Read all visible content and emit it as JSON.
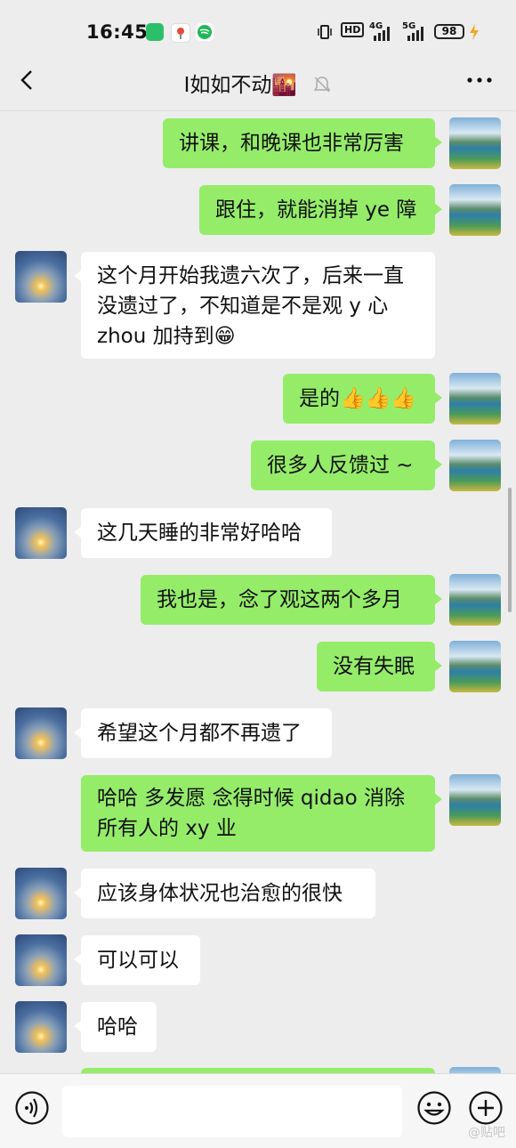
{
  "status": {
    "time": "16:45",
    "hd": "HD",
    "net1": "4G",
    "net2": "5G",
    "battery": "98"
  },
  "header": {
    "title": "I如如不动🌇"
  },
  "messages": [
    {
      "side": "me",
      "text": "讲课，和晚课也非常厉害"
    },
    {
      "side": "me",
      "text": "跟住，就能消掉 ye 障"
    },
    {
      "side": "other",
      "text": "这个月开始我遗六次了，后来一直\n没遗过了，不知道是不是观 y 心\nzhou 加持到😁"
    },
    {
      "side": "me",
      "text": "是的👍👍👍"
    },
    {
      "side": "me",
      "text": "很多人反馈过 ~"
    },
    {
      "side": "other",
      "text": "这几天睡的非常好哈哈"
    },
    {
      "side": "me",
      "text": "我也是，念了观这两个多月"
    },
    {
      "side": "me",
      "text": "没有失眠"
    },
    {
      "side": "other",
      "text": "希望这个月都不再遗了"
    },
    {
      "side": "me",
      "text": "哈哈 多发愿 念得时候 qidao 消除\n所有人的 xy 业"
    },
    {
      "side": "other",
      "text": "应该身体状况也治愈的很快"
    },
    {
      "side": "other",
      "text": "可以可以"
    },
    {
      "side": "other",
      "text": "哈哈"
    }
  ],
  "watermark": "@贴吧",
  "colors": {
    "my_bubble": "#95ec69",
    "other_bubble": "#ffffff",
    "background": "#ededed"
  }
}
